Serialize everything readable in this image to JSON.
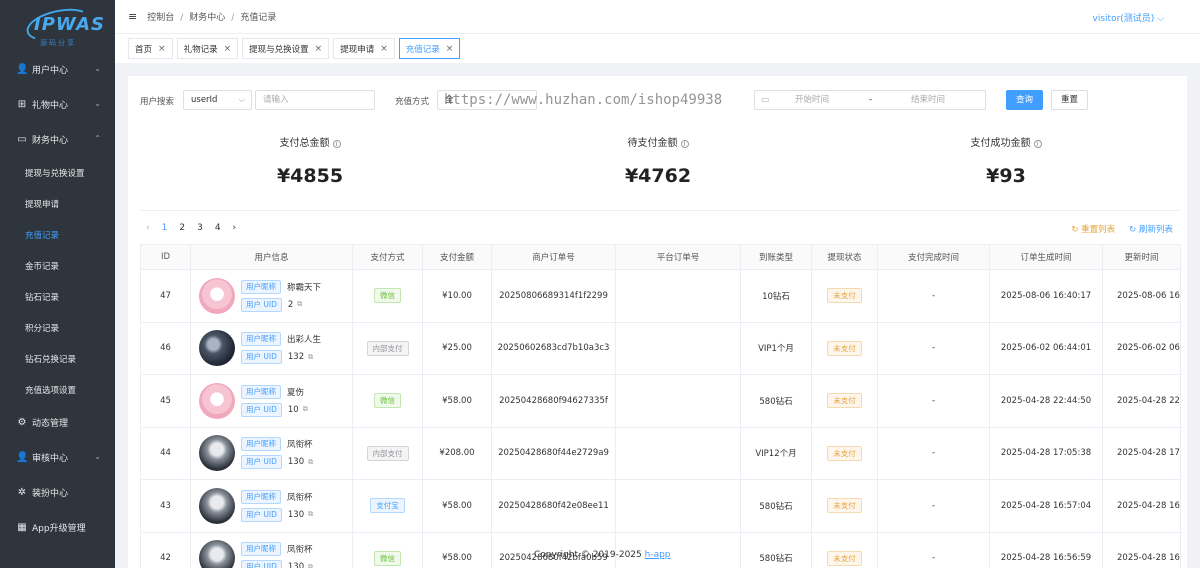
{
  "logo": {
    "text": "IPWAS",
    "sub": "源码分享"
  },
  "sidebar": {
    "items": [
      {
        "label": "用户中心",
        "icon": "user-icon",
        "chev": "⌄"
      },
      {
        "label": "礼物中心",
        "icon": "gift-icon",
        "chev": "⌄"
      },
      {
        "label": "财务中心",
        "icon": "folder-icon",
        "chev": "⌃"
      }
    ],
    "subitems": [
      "提现与兑换设置",
      "提现申请",
      "充值记录",
      "金币记录",
      "钻石记录",
      "积分记录",
      "钻石兑换记录",
      "充值选项设置"
    ],
    "items2": [
      {
        "label": "动态管理",
        "icon": "settings-icon"
      },
      {
        "label": "审核中心",
        "icon": "user-check-icon",
        "chev": "⌄"
      },
      {
        "label": "装扮中心",
        "icon": "sparkle-icon"
      },
      {
        "label": "App升级管理",
        "icon": "grid-icon"
      }
    ]
  },
  "header": {
    "crumbs": [
      "控制台",
      "财务中心",
      "充值记录"
    ],
    "user": "visitor(测试员) ⌵"
  },
  "tabs": [
    {
      "label": "首页"
    },
    {
      "label": "礼物记录"
    },
    {
      "label": "提现与兑换设置"
    },
    {
      "label": "提现申请"
    },
    {
      "label": "充值记录"
    }
  ],
  "filters": {
    "user_search_label": "用户搜索",
    "user_field_value": "userId",
    "user_input_placeholder": "请输入",
    "pay_method_label": "充值方式",
    "pay_method_value": "全",
    "start_placeholder": "开始时间",
    "end_placeholder": "结束时间",
    "range_sep": "-",
    "query_button": "查询",
    "reset_button": "重置"
  },
  "watermark": "https://www.huzhan.com/ishop49938",
  "stats": [
    {
      "title": "支付总金额",
      "value": "¥4855"
    },
    {
      "title": "待支付金额",
      "value": "¥4762"
    },
    {
      "title": "支付成功金额",
      "value": "¥93"
    }
  ],
  "pagination": {
    "prev": "‹",
    "pages": [
      "1",
      "2",
      "3",
      "4"
    ],
    "next": "›"
  },
  "actions": {
    "reset_list": "重置列表",
    "refresh_list": "刷新列表"
  },
  "table": {
    "columns": [
      "ID",
      "用户信息",
      "支付方式",
      "支付金额",
      "商户订单号",
      "平台订单号",
      "到账类型",
      "提现状态",
      "支付完成时间",
      "订单生成时间",
      "更新时间"
    ],
    "nick_tag": "用户昵称",
    "uid_tag": "用户 UID",
    "rows": [
      {
        "id": "47",
        "avatar": "pink",
        "nick": "称霸天下",
        "uid": "2",
        "method": "微信",
        "method_style": "green",
        "amount": "¥10.00",
        "order": "20250806689314f1f2299",
        "platform": "",
        "type": "10钻石",
        "status": "未支付",
        "done": "-",
        "created": "2025-08-06 16:40:17",
        "updated": "2025-08-06 16"
      },
      {
        "id": "46",
        "avatar": "dark",
        "nick": "出彩人生",
        "uid": "132",
        "method": "内部支付",
        "method_style": "gray",
        "amount": "¥25.00",
        "order": "20250602683cd7b10a3c3",
        "platform": "",
        "type": "VIP1个月",
        "status": "未支付",
        "done": "-",
        "created": "2025-06-02 06:44:01",
        "updated": "2025-06-02 06"
      },
      {
        "id": "45",
        "avatar": "pink",
        "nick": "夏伤",
        "uid": "10",
        "method": "微信",
        "method_style": "green",
        "amount": "¥58.00",
        "order": "20250428680f94627335f",
        "platform": "",
        "type": "580钻石",
        "status": "未支付",
        "done": "-",
        "created": "2025-04-28 22:44:50",
        "updated": "2025-04-28 22"
      },
      {
        "id": "44",
        "avatar": "cat",
        "nick": "凤衔杯",
        "uid": "130",
        "method": "内部支付",
        "method_style": "gray",
        "amount": "¥208.00",
        "order": "20250428680f44e2729a9",
        "platform": "",
        "type": "VIP12个月",
        "status": "未支付",
        "done": "-",
        "created": "2025-04-28 17:05:38",
        "updated": "2025-04-28 17"
      },
      {
        "id": "43",
        "avatar": "cat",
        "nick": "凤衔杯",
        "uid": "130",
        "method": "支付宝",
        "method_style": "blue",
        "amount": "¥58.00",
        "order": "20250428680f42e08ee11",
        "platform": "",
        "type": "580钻石",
        "status": "未支付",
        "done": "-",
        "created": "2025-04-28 16:57:04",
        "updated": "2025-04-28 16"
      },
      {
        "id": "42",
        "avatar": "cat",
        "nick": "凤衔杯",
        "uid": "130",
        "method": "微信",
        "method_style": "green",
        "amount": "¥58.00",
        "order": "20250428680f42bfa0b59",
        "platform": "",
        "type": "580钻石",
        "status": "未支付",
        "done": "-",
        "created": "2025-04-28 16:56:59",
        "updated": "2025-04-28 16"
      }
    ]
  },
  "footer": {
    "text": "Copyright © 2019-2025 ",
    "link": "h-app"
  }
}
